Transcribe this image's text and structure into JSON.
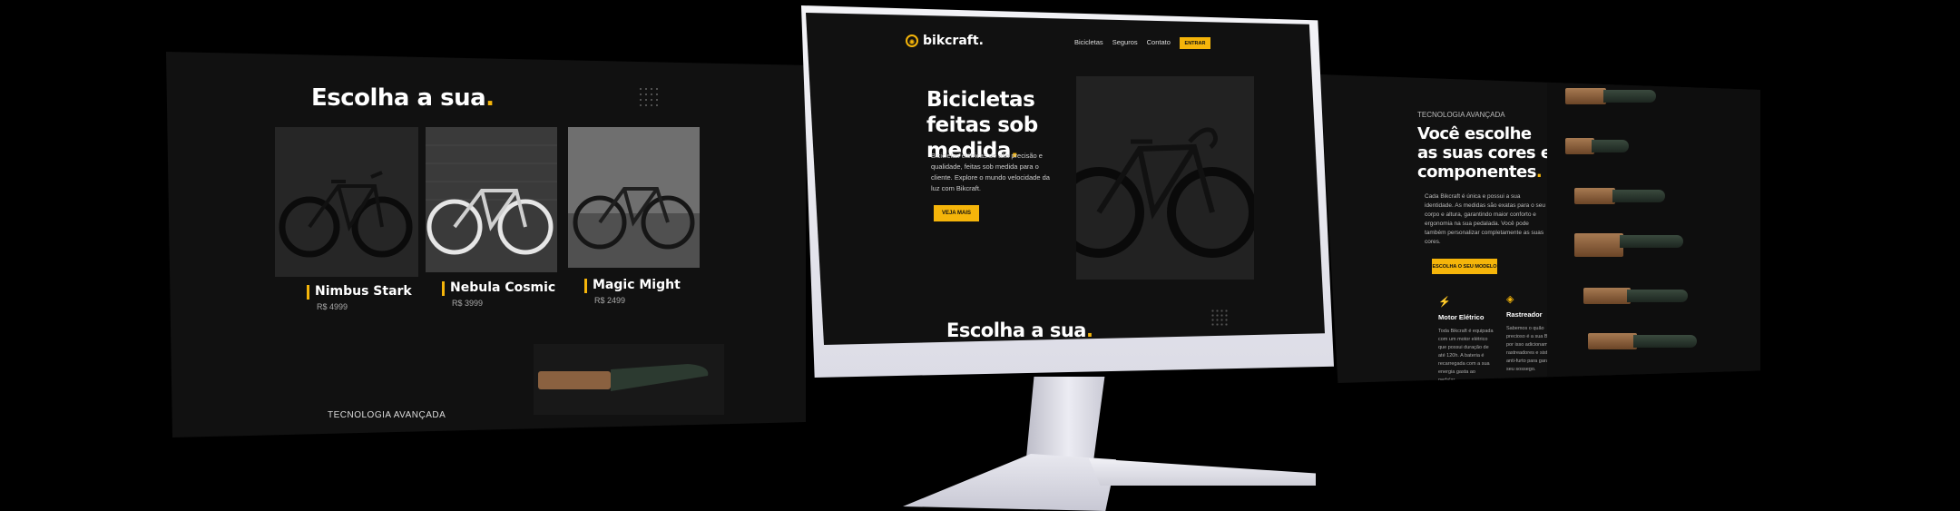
{
  "left_panel": {
    "title": "Escolha a sua",
    "title_dot": ".",
    "products": [
      {
        "name": "Nimbus Stark",
        "price": "R$ 4999"
      },
      {
        "name": "Nebula Cosmic",
        "price": "R$ 3999"
      },
      {
        "name": "Magic Might",
        "price": "R$ 2499"
      }
    ],
    "tech_label": "TECNOLOGIA AVANÇADA"
  },
  "monitor": {
    "logo": "bikcraft.",
    "menu": [
      "Bicicletas",
      "Seguros",
      "Contato"
    ],
    "enter_label": "ENTRAR",
    "hero_title": "Bicicletas feitas sob medida",
    "hero_dot": ".",
    "hero_text": "Bicicletas elétricas de alta precisão e qualidade, feitas sob medida para o cliente. Explore o mundo velocidade da luz com Bikcraft.",
    "hero_button": "VEJA MAIS",
    "section_title": "Escolha a sua",
    "section_dot": "."
  },
  "right_panel": {
    "eyebrow": "TECNOLOGIA AVANÇADA",
    "title": "Você escolhe as suas cores e componentes",
    "title_dot": ".",
    "paragraph": "Cada Bikcraft é única e possui a sua identidade. As medidas são exatas para o seu corpo e altura, garantindo maior conforto e ergonomia na sua pedalada. Você pode também personalizar completamente as suas cores.",
    "cta": "ESCOLHA O SEU MODELO",
    "features": [
      {
        "icon": "bolt-icon",
        "title": "Motor Elétrico",
        "text": "Toda Bikcraft é equipada com um motor elétrico que possui duração de até 120h. A bateria é recarregada com a sua energia gasta ao pedalar."
      },
      {
        "icon": "location-icon",
        "title": "Rastreador",
        "text": "Sabemos o quão precioso é a sua Bikcraft, por isso adicionamos rastreadores e sistemas anti-furto para garantir o seu sossego."
      }
    ]
  },
  "colors": {
    "accent": "#f5b50a",
    "background": "#000000",
    "panel": "#111111"
  }
}
